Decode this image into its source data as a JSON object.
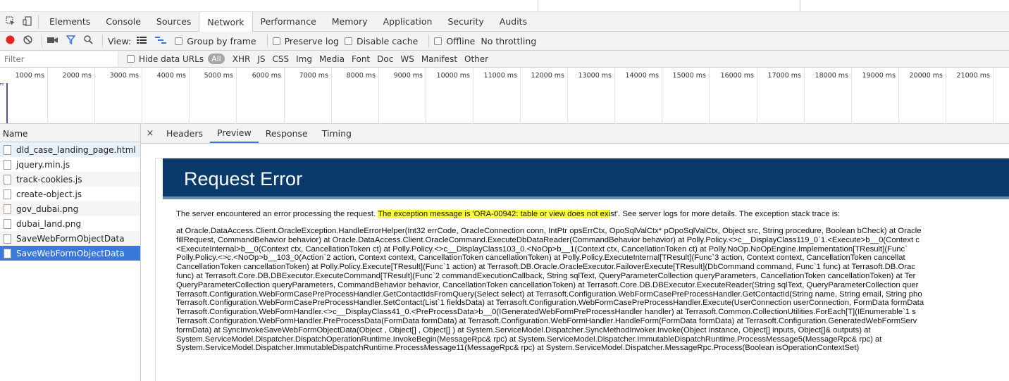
{
  "devtools": {
    "tabs": [
      {
        "label": "Elements"
      },
      {
        "label": "Console"
      },
      {
        "label": "Sources"
      },
      {
        "label": "Network",
        "active": true
      },
      {
        "label": "Performance"
      },
      {
        "label": "Memory"
      },
      {
        "label": "Application"
      },
      {
        "label": "Security"
      },
      {
        "label": "Audits"
      }
    ]
  },
  "network_toolbar": {
    "view_label": "View:",
    "group_by_frame": "Group by frame",
    "preserve_log": "Preserve log",
    "disable_cache": "Disable cache",
    "offline": "Offline",
    "throttling": "No throttling",
    "record_color": "#e8261e",
    "filter_color": "#3879d9"
  },
  "filter_bar": {
    "placeholder": "Filter",
    "hide_data_urls": "Hide data URLs",
    "types": [
      "All",
      "XHR",
      "JS",
      "CSS",
      "Img",
      "Media",
      "Font",
      "Doc",
      "WS",
      "Manifest",
      "Other"
    ]
  },
  "timeline": {
    "ticks": [
      "1000 ms",
      "2000 ms",
      "3000 ms",
      "4000 ms",
      "5000 ms",
      "6000 ms",
      "7000 ms",
      "8000 ms",
      "9000 ms",
      "10000 ms",
      "11000 ms",
      "12000 ms",
      "13000 ms",
      "14000 ms",
      "15000 ms",
      "16000 ms",
      "17000 ms",
      "18000 ms",
      "19000 ms",
      "20000 ms",
      "21000 ms"
    ]
  },
  "request_list": {
    "header": "Name",
    "rows": [
      {
        "name": "dld_case_landing_page.html",
        "icon": "document-icon"
      },
      {
        "name": "jquery.min.js",
        "icon": "script-icon"
      },
      {
        "name": "track-cookies.js",
        "icon": "script-icon"
      },
      {
        "name": "create-object.js",
        "icon": "script-icon"
      },
      {
        "name": "gov_dubai.png",
        "icon": "image-icon"
      },
      {
        "name": "dubai_land.png",
        "icon": "image-icon"
      },
      {
        "name": "SaveWebFormObjectData",
        "icon": "file-icon"
      },
      {
        "name": "SaveWebFormObjectData",
        "icon": "file-icon",
        "selected": true
      }
    ]
  },
  "detail": {
    "close": "×",
    "tabs": [
      {
        "label": "Headers"
      },
      {
        "label": "Preview",
        "active": true
      },
      {
        "label": "Response"
      },
      {
        "label": "Timing"
      }
    ],
    "preview": {
      "title": "Request Error",
      "intro_before": "The server encountered an error processing the request. ",
      "intro_highlight": "The exception message is 'ORA-00942: table or view does not exi",
      "intro_after": "st'. See server logs for more details. The exception stack trace is:",
      "trace_lines": [
        "at Oracle.DataAccess.Client.OracleException.HandleErrorHelper(Int32 errCode, OracleConnection conn, IntPtr opsErrCtx, OpoSqlValCtx* pOpoSqlValCtx, Object src, String procedure, Boolean bCheck) at Oracle",
        "fillRequest, CommandBehavior behavior) at Oracle.DataAccess.Client.OracleCommand.ExecuteDbDataReader(CommandBehavior behavior) at Polly.Policy.<>c__DisplayClass119_0`1.<Execute>b__0(Context c",
        "<ExecuteInternal>b__0(Context ctx, CancellationToken ct) at Polly.Policy.<>c__DisplayClass103_0.<NoOp>b__1(Context ctx, CancellationToken ct) at Polly.NoOp.NoOpEngine.Implementation[TResult](Func`",
        "Polly.Policy.<>c.<NoOp>b__103_0(Action`2 action, Context context, CancellationToken cancellationToken) at Polly.Policy.ExecuteInternal[TResult](Func`3 action, Context context, CancellationToken cancellat",
        "CancellationToken cancellationToken) at Polly.Policy.Execute[TResult](Func`1 action) at Terrasoft.DB.Oracle.OracleExecutor.FailoverExecute[TResult](DbCommand command, Func`1 func) at Terrasoft.DB.Orac",
        "func) at Terrasoft.Core.DB.DBExecutor.ExecuteCommand[TResult](Func`2 commandExecutionCallback, String sqlText, QueryParameterCollection queryParameters, CancellationToken cancellationToken) at Ter",
        "QueryParameterCollection queryParameters, CommandBehavior behavior, CancellationToken cancellationToken) at Terrasoft.Core.DB.DBExecutor.ExecuteReader(String sqlText, QueryParameterCollection quer",
        "Terrasoft.Configuration.WebFormCasePreProcessHandler.GetContactIdsFromQuery(Select select) at Terrasoft.Configuration.WebFormCasePreProcessHandler.GetContactId(String name, String email, String pho",
        "Terrasoft.Configuration.WebFormCasePreProcessHandler.SetContact(List`1 fieldsData) at Terrasoft.Configuration.WebFormCasePreProcessHandler.Execute(UserConnection userConnection, FormData formData",
        "Terrasoft.Configuration.WebFormHandler.<>c__DisplayClass41_0.<PreProcessData>b__0(IGeneratedWebFormPreProcessHandler handler) at Terrasoft.Common.CollectionUtilities.ForEach[T](IEnumerable`1 s",
        "Terrasoft.Configuration.WebFormHandler.PreProcessData(FormData formData) at Terrasoft.Configuration.WebFormHandler.HandleForm(FormData formData) at Terrasoft.Configuration.GeneratedWebFormServ",
        "formData) at SyncInvokeSaveWebFormObjectData(Object , Object[] , Object[] ) at System.ServiceModel.Dispatcher.SyncMethodInvoker.Invoke(Object instance, Object[] inputs, Object[]& outputs) at",
        "System.ServiceModel.Dispatcher.DispatchOperationRuntime.InvokeBegin(MessageRpc& rpc) at System.ServiceModel.Dispatcher.ImmutableDispatchRuntime.ProcessMessage5(MessageRpc& rpc) at",
        "System.ServiceModel.Dispatcher.ImmutableDispatchRuntime.ProcessMessage11(MessageRpc& rpc) at System.ServiceModel.Dispatcher.MessageRpc.Process(Boolean isOperationContextSet)"
      ],
      "banner_color": "#0a3a6b",
      "highlight_color": "#ffff33"
    }
  }
}
